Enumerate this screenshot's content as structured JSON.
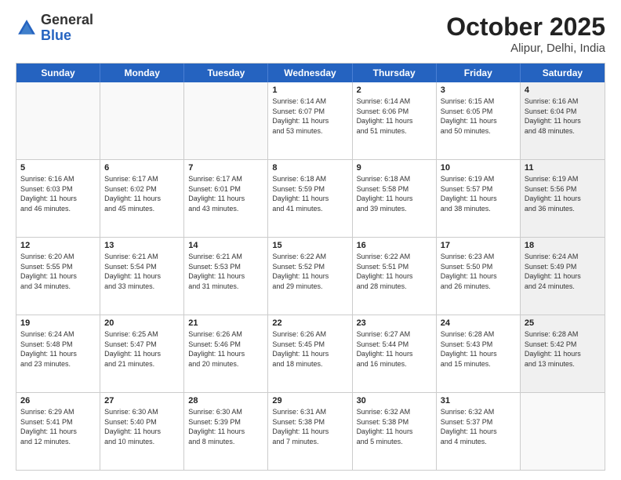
{
  "header": {
    "logo_general": "General",
    "logo_blue": "Blue",
    "month": "October 2025",
    "location": "Alipur, Delhi, India"
  },
  "weekdays": [
    "Sunday",
    "Monday",
    "Tuesday",
    "Wednesday",
    "Thursday",
    "Friday",
    "Saturday"
  ],
  "rows": [
    [
      {
        "day": "",
        "info": "",
        "shaded": false,
        "empty": true
      },
      {
        "day": "",
        "info": "",
        "shaded": false,
        "empty": true
      },
      {
        "day": "",
        "info": "",
        "shaded": false,
        "empty": true
      },
      {
        "day": "1",
        "info": "Sunrise: 6:14 AM\nSunset: 6:07 PM\nDaylight: 11 hours\nand 53 minutes.",
        "shaded": false,
        "empty": false
      },
      {
        "day": "2",
        "info": "Sunrise: 6:14 AM\nSunset: 6:06 PM\nDaylight: 11 hours\nand 51 minutes.",
        "shaded": false,
        "empty": false
      },
      {
        "day": "3",
        "info": "Sunrise: 6:15 AM\nSunset: 6:05 PM\nDaylight: 11 hours\nand 50 minutes.",
        "shaded": false,
        "empty": false
      },
      {
        "day": "4",
        "info": "Sunrise: 6:16 AM\nSunset: 6:04 PM\nDaylight: 11 hours\nand 48 minutes.",
        "shaded": true,
        "empty": false
      }
    ],
    [
      {
        "day": "5",
        "info": "Sunrise: 6:16 AM\nSunset: 6:03 PM\nDaylight: 11 hours\nand 46 minutes.",
        "shaded": false,
        "empty": false
      },
      {
        "day": "6",
        "info": "Sunrise: 6:17 AM\nSunset: 6:02 PM\nDaylight: 11 hours\nand 45 minutes.",
        "shaded": false,
        "empty": false
      },
      {
        "day": "7",
        "info": "Sunrise: 6:17 AM\nSunset: 6:01 PM\nDaylight: 11 hours\nand 43 minutes.",
        "shaded": false,
        "empty": false
      },
      {
        "day": "8",
        "info": "Sunrise: 6:18 AM\nSunset: 5:59 PM\nDaylight: 11 hours\nand 41 minutes.",
        "shaded": false,
        "empty": false
      },
      {
        "day": "9",
        "info": "Sunrise: 6:18 AM\nSunset: 5:58 PM\nDaylight: 11 hours\nand 39 minutes.",
        "shaded": false,
        "empty": false
      },
      {
        "day": "10",
        "info": "Sunrise: 6:19 AM\nSunset: 5:57 PM\nDaylight: 11 hours\nand 38 minutes.",
        "shaded": false,
        "empty": false
      },
      {
        "day": "11",
        "info": "Sunrise: 6:19 AM\nSunset: 5:56 PM\nDaylight: 11 hours\nand 36 minutes.",
        "shaded": true,
        "empty": false
      }
    ],
    [
      {
        "day": "12",
        "info": "Sunrise: 6:20 AM\nSunset: 5:55 PM\nDaylight: 11 hours\nand 34 minutes.",
        "shaded": false,
        "empty": false
      },
      {
        "day": "13",
        "info": "Sunrise: 6:21 AM\nSunset: 5:54 PM\nDaylight: 11 hours\nand 33 minutes.",
        "shaded": false,
        "empty": false
      },
      {
        "day": "14",
        "info": "Sunrise: 6:21 AM\nSunset: 5:53 PM\nDaylight: 11 hours\nand 31 minutes.",
        "shaded": false,
        "empty": false
      },
      {
        "day": "15",
        "info": "Sunrise: 6:22 AM\nSunset: 5:52 PM\nDaylight: 11 hours\nand 29 minutes.",
        "shaded": false,
        "empty": false
      },
      {
        "day": "16",
        "info": "Sunrise: 6:22 AM\nSunset: 5:51 PM\nDaylight: 11 hours\nand 28 minutes.",
        "shaded": false,
        "empty": false
      },
      {
        "day": "17",
        "info": "Sunrise: 6:23 AM\nSunset: 5:50 PM\nDaylight: 11 hours\nand 26 minutes.",
        "shaded": false,
        "empty": false
      },
      {
        "day": "18",
        "info": "Sunrise: 6:24 AM\nSunset: 5:49 PM\nDaylight: 11 hours\nand 24 minutes.",
        "shaded": true,
        "empty": false
      }
    ],
    [
      {
        "day": "19",
        "info": "Sunrise: 6:24 AM\nSunset: 5:48 PM\nDaylight: 11 hours\nand 23 minutes.",
        "shaded": false,
        "empty": false
      },
      {
        "day": "20",
        "info": "Sunrise: 6:25 AM\nSunset: 5:47 PM\nDaylight: 11 hours\nand 21 minutes.",
        "shaded": false,
        "empty": false
      },
      {
        "day": "21",
        "info": "Sunrise: 6:26 AM\nSunset: 5:46 PM\nDaylight: 11 hours\nand 20 minutes.",
        "shaded": false,
        "empty": false
      },
      {
        "day": "22",
        "info": "Sunrise: 6:26 AM\nSunset: 5:45 PM\nDaylight: 11 hours\nand 18 minutes.",
        "shaded": false,
        "empty": false
      },
      {
        "day": "23",
        "info": "Sunrise: 6:27 AM\nSunset: 5:44 PM\nDaylight: 11 hours\nand 16 minutes.",
        "shaded": false,
        "empty": false
      },
      {
        "day": "24",
        "info": "Sunrise: 6:28 AM\nSunset: 5:43 PM\nDaylight: 11 hours\nand 15 minutes.",
        "shaded": false,
        "empty": false
      },
      {
        "day": "25",
        "info": "Sunrise: 6:28 AM\nSunset: 5:42 PM\nDaylight: 11 hours\nand 13 minutes.",
        "shaded": true,
        "empty": false
      }
    ],
    [
      {
        "day": "26",
        "info": "Sunrise: 6:29 AM\nSunset: 5:41 PM\nDaylight: 11 hours\nand 12 minutes.",
        "shaded": false,
        "empty": false
      },
      {
        "day": "27",
        "info": "Sunrise: 6:30 AM\nSunset: 5:40 PM\nDaylight: 11 hours\nand 10 minutes.",
        "shaded": false,
        "empty": false
      },
      {
        "day": "28",
        "info": "Sunrise: 6:30 AM\nSunset: 5:39 PM\nDaylight: 11 hours\nand 8 minutes.",
        "shaded": false,
        "empty": false
      },
      {
        "day": "29",
        "info": "Sunrise: 6:31 AM\nSunset: 5:38 PM\nDaylight: 11 hours\nand 7 minutes.",
        "shaded": false,
        "empty": false
      },
      {
        "day": "30",
        "info": "Sunrise: 6:32 AM\nSunset: 5:38 PM\nDaylight: 11 hours\nand 5 minutes.",
        "shaded": false,
        "empty": false
      },
      {
        "day": "31",
        "info": "Sunrise: 6:32 AM\nSunset: 5:37 PM\nDaylight: 11 hours\nand 4 minutes.",
        "shaded": false,
        "empty": false
      },
      {
        "day": "",
        "info": "",
        "shaded": true,
        "empty": true
      }
    ]
  ]
}
